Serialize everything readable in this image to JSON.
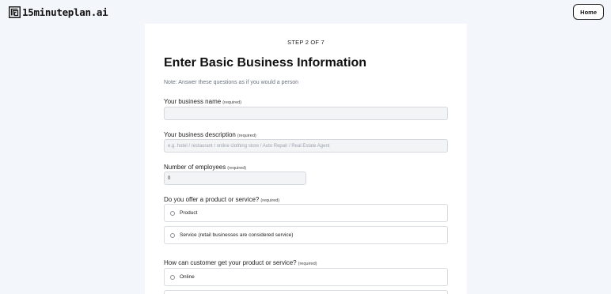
{
  "header": {
    "logo_text": "15minuteplan.ai",
    "home_label": "Home"
  },
  "form": {
    "step": "STEP 2 OF 7",
    "title": "Enter Basic Business Information",
    "note": "Note: Answer these questions as if you would a person",
    "business_name": {
      "label": "Your business name",
      "required": "(required)",
      "value": ""
    },
    "business_description": {
      "label": "Your business description",
      "required": "(required)",
      "placeholder": "e.g. hotel / restaurant / online clothing store / Auto Repair / Real Estate Agent"
    },
    "employees": {
      "label": "Number of employees",
      "required": "(required)",
      "value": "0"
    },
    "offer": {
      "label": "Do you offer a product or service?",
      "required": "(required)",
      "options": [
        "Product",
        "Service (retail businesses are considered service)"
      ]
    },
    "channel": {
      "label": "How can customer get your product or service?",
      "required": "(required)",
      "options": [
        "Online",
        ""
      ]
    }
  }
}
